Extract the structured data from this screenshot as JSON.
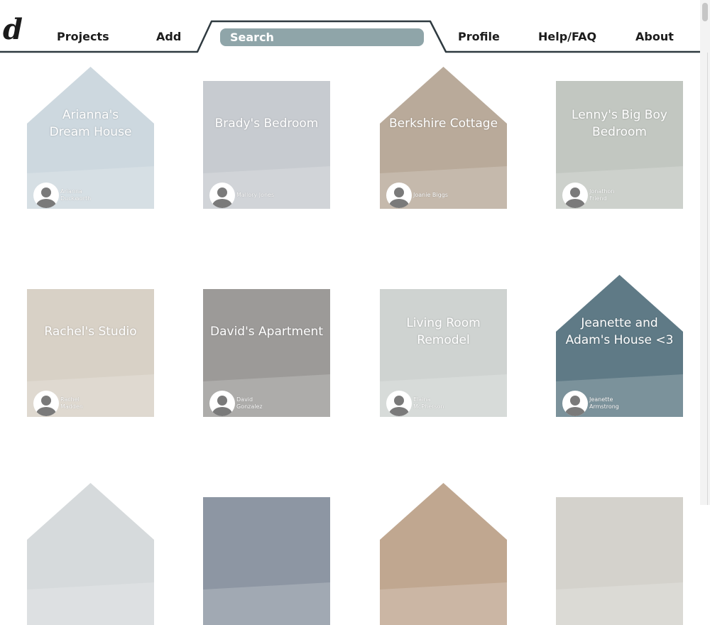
{
  "logo": "d",
  "nav": {
    "projects": "Projects",
    "add": "Add",
    "profile": "Profile",
    "help": "Help/FAQ",
    "about": "About"
  },
  "search": {
    "placeholder": "Search"
  },
  "colors": {
    "search_bg": "#8fa5a9",
    "header_line": "#2f3a40"
  },
  "projects": [
    {
      "title_lines": [
        "Arianna's",
        "Dream House"
      ],
      "owner": "Arianna Duckworth",
      "shape": "house",
      "tint": "#cdd8df"
    },
    {
      "title_lines": [
        "Brady's Bedroom"
      ],
      "owner": "Mallory Jones",
      "shape": "square",
      "tint": "#c7cbd0"
    },
    {
      "title_lines": [
        "Berkshire Cottage"
      ],
      "owner": "Joanie Biggs",
      "shape": "house",
      "tint": "#b9aa9a"
    },
    {
      "title_lines": [
        "Lenny's Big Boy",
        "Bedroom"
      ],
      "owner": "Jonathon Friend",
      "shape": "square",
      "tint": "#c2c7c1"
    },
    {
      "title_lines": [
        "Rachel's Studio"
      ],
      "owner": "Rachel Madden",
      "shape": "square",
      "tint": "#d8d1c6"
    },
    {
      "title_lines": [
        "David's Apartment"
      ],
      "owner": "David Gonzalez",
      "shape": "square",
      "tint": "#9c9a98"
    },
    {
      "title_lines": [
        "Living Room",
        "Remodel"
      ],
      "owner": "Elaina McPherson",
      "shape": "square",
      "tint": "#cfd3d1"
    },
    {
      "title_lines": [
        "Jeanette and",
        "Adam's House <3"
      ],
      "owner": "Jeanette Armstrong",
      "shape": "house",
      "tint": "#5f7a86"
    },
    {
      "title_lines": [],
      "owner": "",
      "shape": "house",
      "tint": "#d6dadc"
    },
    {
      "title_lines": [],
      "owner": "",
      "shape": "square",
      "tint": "#8d96a3"
    },
    {
      "title_lines": [],
      "owner": "",
      "shape": "house",
      "tint": "#c0a790"
    },
    {
      "title_lines": [],
      "owner": "",
      "shape": "square",
      "tint": "#d4d2cc"
    }
  ]
}
